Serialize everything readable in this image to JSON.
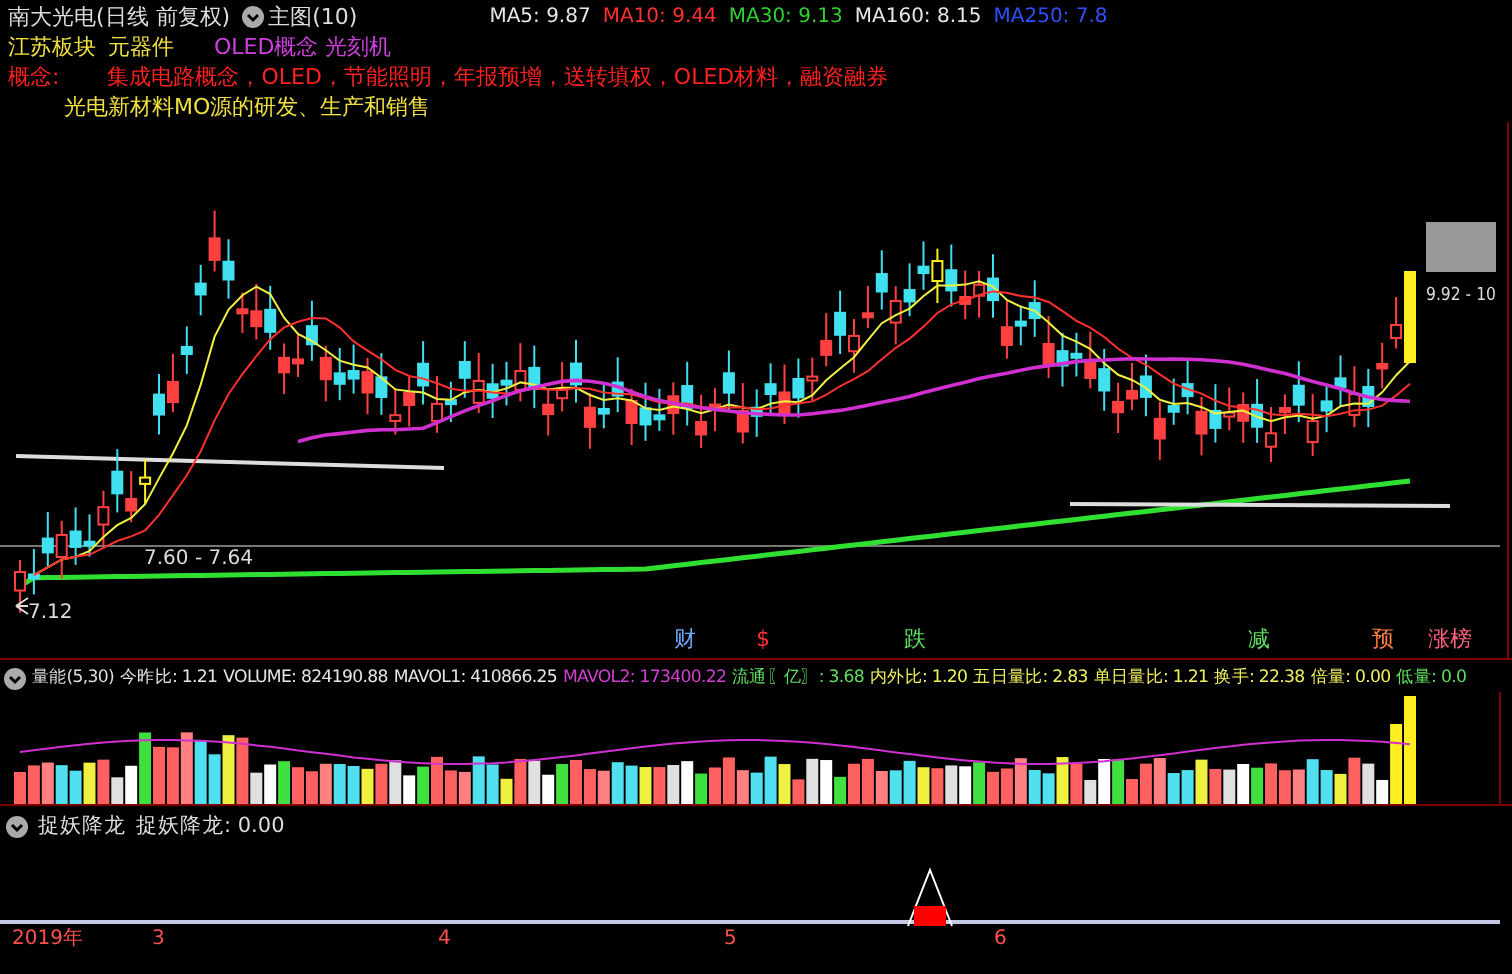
{
  "header": {
    "title": "南大光电(日线 前复权)",
    "chart_selector": "主图(10)",
    "moving_averages": [
      {
        "label": "MA5: 9.87",
        "color": "#e6e6e6"
      },
      {
        "label": "MA10: 9.44",
        "color": "#ff3030"
      },
      {
        "label": "MA30: 9.13",
        "color": "#30d030"
      },
      {
        "label": "MA160: 8.15",
        "color": "#e6e6e6"
      },
      {
        "label": "MA250: 7.8",
        "color": "#3050ff"
      }
    ]
  },
  "info": {
    "sector": "江苏板块",
    "industry": "元器件",
    "themes": "OLED概念 光刻机",
    "concept_label": "概念:",
    "concepts": "集成电路概念，OLED，节能照明，年报预增，送转填权，OLED材料，融资融券",
    "business": "光电新材料MO源的研发、生产和销售"
  },
  "chart": {
    "price_labels": [
      "9.92 - 10",
      "7.60 - 7.64",
      "7.12"
    ],
    "events": [
      {
        "label": "财",
        "color": "#6fa8ff"
      },
      {
        "label": "$",
        "color": "#ff3030"
      },
      {
        "label": "跌",
        "color": "#60e060"
      },
      {
        "label": "减",
        "color": "#60e060"
      },
      {
        "label": "预",
        "color": "#ff8040"
      },
      {
        "label": "涨榜",
        "color": "#ff6080"
      }
    ]
  },
  "volume": {
    "title": "量能(5,30)",
    "stats": [
      {
        "label": "今昨比: 1.21",
        "color": "#e6e6e6"
      },
      {
        "label": "VOLUME: 824190.88",
        "color": "#e6e6e6"
      },
      {
        "label": "MAVOL1: 410866.25",
        "color": "#e6e6e6"
      },
      {
        "label": "MAVOL2: 173400.22",
        "color": "#d040d0"
      },
      {
        "label": "流通〖亿〗: 3.68",
        "color": "#60e060"
      },
      {
        "label": "内外比: 1.20",
        "color": "#f0f060"
      },
      {
        "label": "五日量比: 2.83",
        "color": "#f0f060"
      },
      {
        "label": "单日量比: 1.21",
        "color": "#f0f060"
      },
      {
        "label": "换手: 22.38",
        "color": "#f0f060"
      },
      {
        "label": "倍量: 0.00",
        "color": "#f0f060"
      },
      {
        "label": "低量: 0.0",
        "color": "#60e060"
      }
    ]
  },
  "indicator": {
    "title": "捉妖降龙",
    "value": "捉妖降龙: 0.00"
  },
  "axis": [
    "2019年",
    "3",
    "4",
    "5",
    "6"
  ]
}
